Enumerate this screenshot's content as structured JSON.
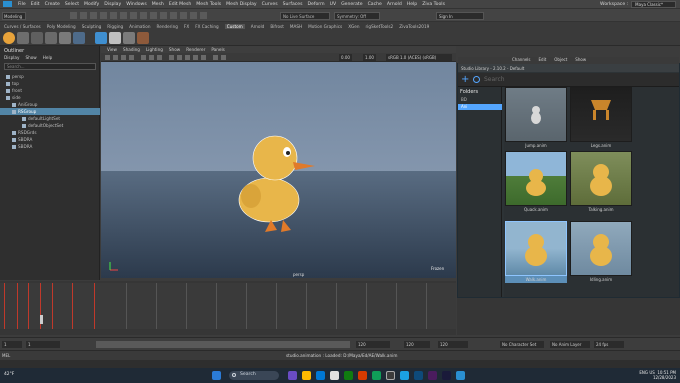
{
  "menubar": {
    "items": [
      "File",
      "Edit",
      "Create",
      "Select",
      "Modify",
      "Display",
      "Windows",
      "Mesh",
      "Edit Mesh",
      "Mesh Tools",
      "Mesh Display",
      "Curves",
      "Surfaces",
      "Deform",
      "UV",
      "Generate",
      "Cache",
      "Arnold",
      "Help",
      "Ziva Tools"
    ],
    "workspace_label": "Workspace :",
    "workspace_value": "Maya Classic*"
  },
  "statusline": {
    "mode": "Modeling",
    "live_surface": "No Live Surface",
    "symmetry": "Symmetry: Off",
    "sign_in": "Sign In"
  },
  "shelf_tabs": [
    "Curves / Surfaces",
    "Poly Modeling",
    "Sculpting",
    "Rigging",
    "Animation",
    "Rendering",
    "FX",
    "FX Caching",
    "Custom",
    "Arnold",
    "Bifrost",
    "MASH",
    "Motion Graphics",
    "XGen",
    "rigSketTools2",
    "ZivaTools2019"
  ],
  "shelf_active": "Custom",
  "outliner": {
    "title": "Outliner",
    "menu": [
      "Display",
      "Show",
      "Help"
    ],
    "search_placeholder": "Search...",
    "items": [
      "persp",
      "top",
      "front",
      "side",
      "AniGroup",
      "RSGroup",
      "defaultLightSet",
      "defaultObjectSet",
      "RSDGrds",
      "SBDRA",
      "SBDRA"
    ],
    "selected_index": 5
  },
  "viewport": {
    "menu": [
      "View",
      "Shading",
      "Lighting",
      "Show",
      "Renderer",
      "Panels"
    ],
    "gamma": "0.00",
    "exposure": "1.00",
    "color_space": "sRGB 1.0 (ACES) (sRGB)",
    "camera": "persp",
    "fps": "Frozen"
  },
  "studio_library": {
    "title": "Studio Library - 2.10.2 - Default",
    "menu": [
      "Channels",
      "Edit",
      "Object",
      "Show"
    ],
    "search_placeholder": "Search",
    "folders_header": "Folders",
    "folders": [
      "BD",
      "Ani"
    ],
    "selected_folder": 1,
    "items": [
      {
        "label": "Jump.anim"
      },
      {
        "label": "Legs.anim"
      },
      {
        "label": "Quack.anim"
      },
      {
        "label": "Talking.anim"
      },
      {
        "label": "Walk.anim"
      },
      {
        "label": "Idling.anim"
      }
    ],
    "selected_item": 4
  },
  "range": {
    "start": "1",
    "start_inner": "1",
    "end_inner": "120",
    "end": "120",
    "current": "120",
    "character_set": "No Character Set",
    "anim_layer": "No Anim Layer",
    "fps": "24 fps"
  },
  "cmdline": {
    "mel_label": "MEL",
    "message": "studio.animation : Loaded: D:/Maya/Ed/AE/Walk.anim"
  },
  "taskbar": {
    "weather": "42°F",
    "search_label": "Search",
    "lang": "ENG",
    "region": "US",
    "time": "10:51 PM",
    "date": "12/28/2023"
  }
}
